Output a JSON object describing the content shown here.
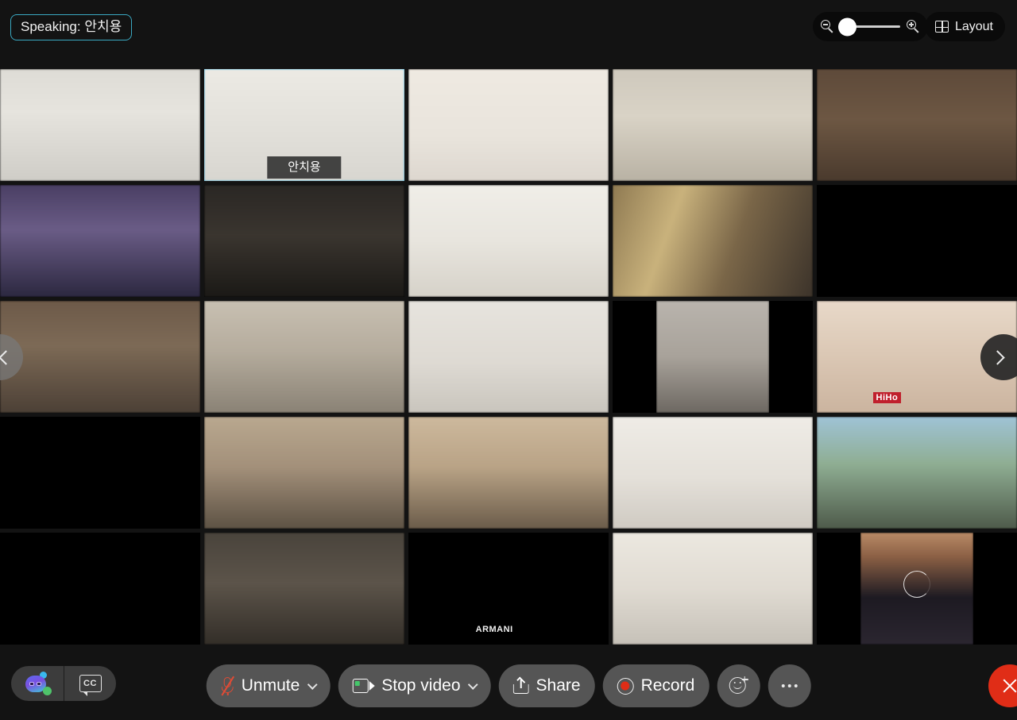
{
  "header": {
    "speaking_label": "Speaking: 안치용",
    "zoom": {
      "zoom_out_icon": "zoom-out-icon",
      "zoom_in_icon": "zoom-in-icon",
      "value": 0
    },
    "layout_button": "Layout",
    "layout_icon": "grid-icon"
  },
  "grid": {
    "columns": 5,
    "rows": 5,
    "active_speaker_name": "안치용",
    "prev_arrow_icon": "chevron-left-icon",
    "next_arrow_icon": "chevron-right-icon",
    "tiles": [
      {
        "id": 1,
        "style": "office-ceiling-lights-masked-woman",
        "active": false,
        "pillarbox": false
      },
      {
        "id": 2,
        "style": "office-man-glasses-speaking",
        "active": true,
        "pillarbox": false,
        "name": "안치용"
      },
      {
        "id": 3,
        "style": "bookshelf-young-man",
        "active": false,
        "pillarbox": false
      },
      {
        "id": 4,
        "style": "curtain-room-woman-orange-top",
        "active": false,
        "pillarbox": false
      },
      {
        "id": 5,
        "style": "plants-woman-mask-glasses",
        "active": false,
        "pillarbox": false
      },
      {
        "id": 6,
        "style": "purple-wall-woman-dark-top",
        "active": false,
        "pillarbox": false
      },
      {
        "id": 7,
        "style": "dark-room-man-mask",
        "active": false,
        "pillarbox": false
      },
      {
        "id": 8,
        "style": "bright-wall-woman-blurred",
        "active": false,
        "pillarbox": false
      },
      {
        "id": 9,
        "style": "sunlight-wall-woman-dark-top",
        "active": false,
        "pillarbox": false
      },
      {
        "id": 10,
        "style": "bookshelf-backlit-person",
        "active": false,
        "pillarbox": false
      },
      {
        "id": 11,
        "style": "closeup-woman-patterned-top",
        "active": false,
        "pillarbox": false
      },
      {
        "id": 12,
        "style": "man-mask-grey-shirt-hand-up",
        "active": false,
        "pillarbox": false
      },
      {
        "id": 13,
        "style": "corridor-person-distant",
        "active": false,
        "pillarbox": false
      },
      {
        "id": 14,
        "style": "portrait-woman-white-mask",
        "active": false,
        "pillarbox": true
      },
      {
        "id": 15,
        "style": "woman-dark-tee-hiho-logo",
        "active": false,
        "pillarbox": false,
        "logo": "HiHo"
      },
      {
        "id": 16,
        "style": "home-man-bright-window",
        "active": false,
        "pillarbox": false
      },
      {
        "id": 17,
        "style": "bookcase-woman-seated",
        "active": false,
        "pillarbox": false
      },
      {
        "id": 18,
        "style": "living-room-woman-green-cap",
        "active": false,
        "pillarbox": false
      },
      {
        "id": 19,
        "style": "white-room-man-dark-hair",
        "active": false,
        "pillarbox": false
      },
      {
        "id": 20,
        "style": "mountain-backdrop-woman-glasses",
        "active": false,
        "pillarbox": false
      },
      {
        "id": 21,
        "style": "sofa-woman-mask-framed-art",
        "active": false,
        "pillarbox": false
      },
      {
        "id": 22,
        "style": "dim-room-person-lamp",
        "active": false,
        "pillarbox": false
      },
      {
        "id": 23,
        "style": "woman-armani-sweatshirt",
        "active": false,
        "pillarbox": false,
        "logo": "ARMANI"
      },
      {
        "id": 24,
        "style": "bright-room-woman-long-hair",
        "active": false,
        "pillarbox": false
      },
      {
        "id": 25,
        "style": "portrait-woman-bangs-loading",
        "active": false,
        "pillarbox": true,
        "loading": true
      }
    ]
  },
  "toolbar": {
    "ai_companion_icon": "ai-companion-icon",
    "captions_icon": "closed-captions-icon",
    "captions_label": "CC",
    "audio": {
      "label": "Unmute",
      "icon": "microphone-muted-icon",
      "caret": "chevron-down-icon"
    },
    "video": {
      "label": "Stop video",
      "icon": "camera-on-icon",
      "caret": "chevron-down-icon"
    },
    "share": {
      "label": "Share",
      "icon": "share-screen-icon"
    },
    "record": {
      "label": "Record",
      "icon": "record-icon"
    },
    "reactions": {
      "icon": "reactions-icon"
    },
    "more": {
      "icon": "more-options-icon"
    },
    "leave": {
      "icon": "leave-meeting-icon"
    }
  },
  "colors": {
    "background": "#131313",
    "active_border": "#1fa7e0",
    "speaking_border": "#3aa8c1",
    "control_bg": "#555555",
    "leave_red": "#e02d17",
    "record_red": "#e02d17",
    "status_green": "#4fc36a"
  }
}
